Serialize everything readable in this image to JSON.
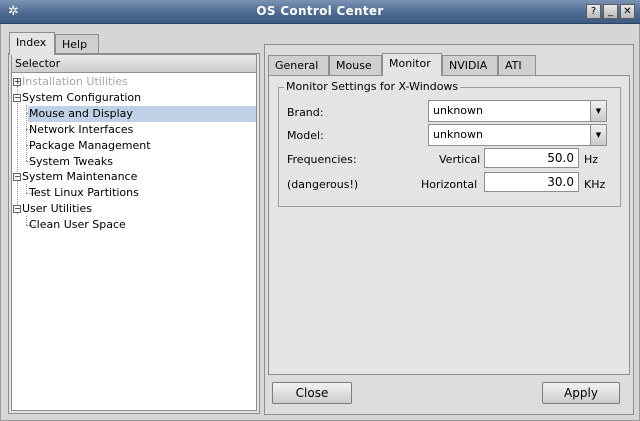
{
  "window": {
    "title": "OS Control Center",
    "help_btn": "?",
    "min_btn": "_",
    "close_btn": "✕",
    "app_icon": "gear-icon"
  },
  "left_tabs": [
    "Index",
    "Help"
  ],
  "tree": {
    "header": "Selector",
    "items": [
      {
        "label": "Installation Utilities",
        "disabled": true,
        "expander": "+"
      },
      {
        "label": "System Configuration",
        "expander": "−"
      },
      {
        "label": "Mouse and Display",
        "selected": true
      },
      {
        "label": "Network Interfaces"
      },
      {
        "label": "Package Management"
      },
      {
        "label": "System Tweaks"
      },
      {
        "label": "System Maintenance",
        "expander": "−"
      },
      {
        "label": "Test Linux Partitions"
      },
      {
        "label": "User Utilities",
        "expander": "−"
      },
      {
        "label": "Clean User Space"
      }
    ]
  },
  "right_tabs": [
    "General",
    "Mouse",
    "Monitor",
    "NVIDIA",
    "ATI"
  ],
  "active_right_tab": "Monitor",
  "monitor": {
    "group_title": "Monitor Settings for X-Windows",
    "brand_label": "Brand:",
    "brand_value": "unknown",
    "model_label": "Model:",
    "model_value": "unknown",
    "freq_label": "Frequencies:",
    "dangerous_label": "(dangerous!)",
    "vertical_label": "Vertical",
    "vertical_value": "50.0",
    "vertical_unit": "Hz",
    "horizontal_label": "Horizontal",
    "horizontal_value": "30.0",
    "horizontal_unit": "KHz"
  },
  "buttons": {
    "close": "Close",
    "apply": "Apply"
  },
  "colors": {
    "titlebar": "#4d6a92",
    "selection": "#c0d0e6"
  }
}
